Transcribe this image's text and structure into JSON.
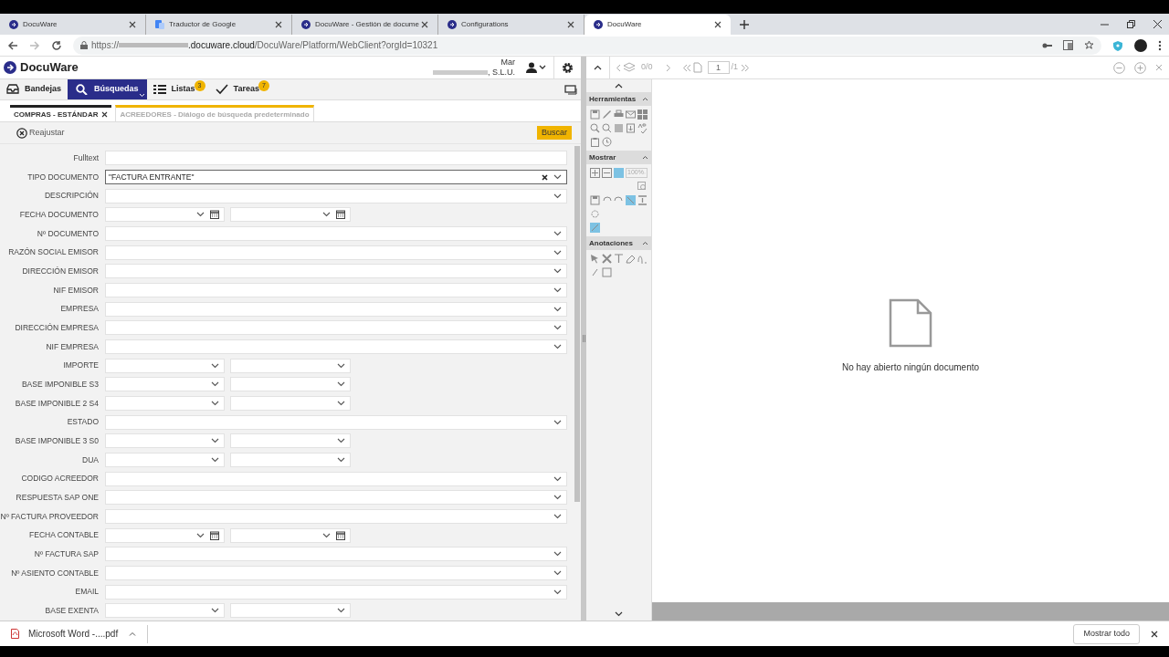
{
  "browser": {
    "tabs": [
      {
        "title": "DocuWare",
        "selected": false
      },
      {
        "title": "Traductor de Google",
        "selected": false
      },
      {
        "title": "DocuWare - Gestión de docume",
        "selected": false
      },
      {
        "title": "Configurations",
        "selected": false
      },
      {
        "title": "DocuWare",
        "selected": true
      }
    ],
    "url": {
      "scheme": "https://",
      "domain": ".docuware.cloud",
      "path": "/DocuWare/Platform/WebClient?orgId=10321"
    }
  },
  "app": {
    "logo": "DocuWare",
    "user": {
      "name": "Mar",
      "company": ", S.L.U."
    },
    "nav": [
      {
        "label": "Bandejas",
        "selected": false
      },
      {
        "label": "Búsquedas",
        "selected": true
      },
      {
        "label": "Listas",
        "selected": false,
        "badge": "3"
      },
      {
        "label": "Tareas",
        "selected": false,
        "badge": "7"
      }
    ],
    "search_tabs": [
      {
        "label": "COMPRAS - ESTÁNDAR",
        "selected": true
      },
      {
        "label": "ACREEDORES - Diálogo de búsqueda predeterminado",
        "selected": false
      }
    ],
    "reset_label": "Reajustar",
    "search_button": "Buscar",
    "fields": [
      {
        "label": "Fulltext",
        "kind": "text",
        "focused": false
      },
      {
        "label": "TIPO DOCUMENTO",
        "kind": "full",
        "focused": true,
        "value": "\"FACTURA ENTRANTE\""
      },
      {
        "label": "DESCRIPCIÓN",
        "kind": "full",
        "focused": false
      },
      {
        "label": "FECHA DOCUMENTO",
        "kind": "date",
        "focused": false
      },
      {
        "label": "Nº DOCUMENTO",
        "kind": "full",
        "focused": false
      },
      {
        "label": "RAZÓN SOCIAL EMISOR",
        "kind": "full",
        "focused": false
      },
      {
        "label": "DIRECCIÓN EMISOR",
        "kind": "full",
        "focused": false
      },
      {
        "label": "NIF EMISOR",
        "kind": "full",
        "focused": false
      },
      {
        "label": "EMPRESA",
        "kind": "full",
        "focused": false
      },
      {
        "label": "DIRECCIÓN EMPRESA",
        "kind": "full",
        "focused": false
      },
      {
        "label": "NIF EMPRESA",
        "kind": "full",
        "focused": false
      },
      {
        "label": "IMPORTE",
        "kind": "range",
        "focused": false
      },
      {
        "label": "BASE IMPONIBLE S3",
        "kind": "range",
        "focused": false
      },
      {
        "label": "BASE IMPONIBLE 2 S4",
        "kind": "range",
        "focused": false
      },
      {
        "label": "ESTADO",
        "kind": "full",
        "focused": false
      },
      {
        "label": "BASE IMPONIBLE 3 S0",
        "kind": "range",
        "focused": false
      },
      {
        "label": "DUA",
        "kind": "range",
        "focused": false
      },
      {
        "label": "CODIGO ACREEDOR",
        "kind": "full",
        "focused": false
      },
      {
        "label": "RESPUESTA SAP ONE",
        "kind": "full",
        "focused": false
      },
      {
        "label": "Nº FACTURA PROVEEDOR",
        "kind": "full",
        "focused": false
      },
      {
        "label": "FECHA CONTABLE",
        "kind": "date",
        "focused": false
      },
      {
        "label": "Nº FACTURA SAP",
        "kind": "full",
        "focused": false
      },
      {
        "label": "Nº ASIENTO CONTABLE",
        "kind": "full",
        "focused": false
      },
      {
        "label": "EMAIL",
        "kind": "full",
        "focused": false
      },
      {
        "label": "BASE EXENTA",
        "kind": "range",
        "focused": false
      }
    ]
  },
  "viewer": {
    "page_count": "0/0",
    "page_input": "1",
    "page_total": "/1",
    "sections": [
      {
        "title": "Herramientas"
      },
      {
        "title": "Mostrar"
      },
      {
        "title": "Anotaciones"
      }
    ],
    "zoom": "100%",
    "empty_message": "No hay abierto ningún documento"
  },
  "downloads": {
    "file": "Microsoft Word -....pdf",
    "show_all": "Mostrar todo"
  }
}
